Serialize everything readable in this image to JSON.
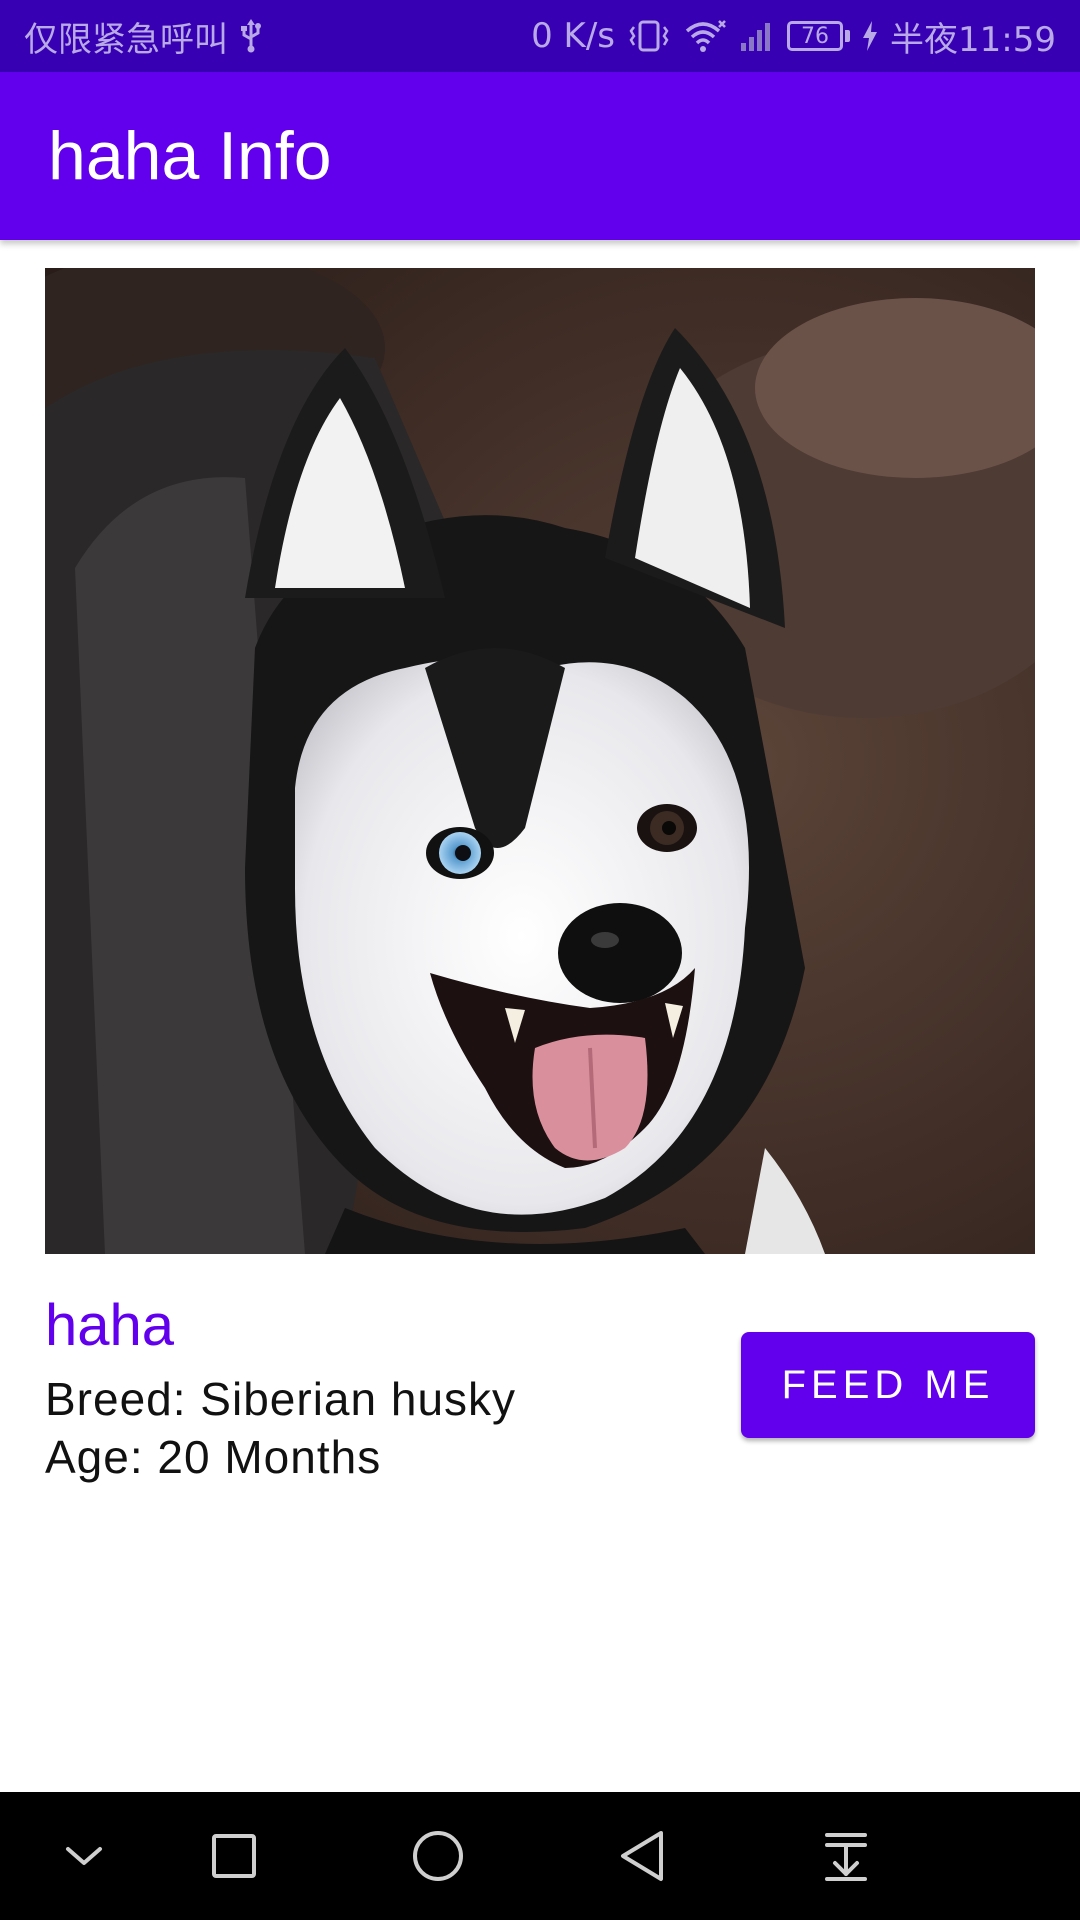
{
  "status_bar": {
    "carrier_text": "仅限紧急呼叫",
    "usb_icon": "usb-icon",
    "net_speed": "0 K/s",
    "vibrate_icon": "vibrate-icon",
    "wifi_icon": "wifi-icon",
    "signal_icon": "signal-icon",
    "battery_level": "76",
    "charging_icon": "charging-icon",
    "time": "半夜11:59"
  },
  "app_bar": {
    "title": "haha Info"
  },
  "dog": {
    "photo_icon": "husky-photo",
    "name": "haha",
    "breed": "Breed: Siberian husky",
    "age": "Age: 20 Months",
    "feed_label": "FEED ME"
  },
  "nav_bar": {
    "buttons": [
      "chevron-down-icon",
      "square-icon",
      "circle-icon",
      "triangle-back-icon",
      "download-icon"
    ]
  },
  "colors": {
    "status_bar": "#3700b3",
    "primary": "#6200ee",
    "text": "#111111",
    "nav_bar": "#000000"
  }
}
